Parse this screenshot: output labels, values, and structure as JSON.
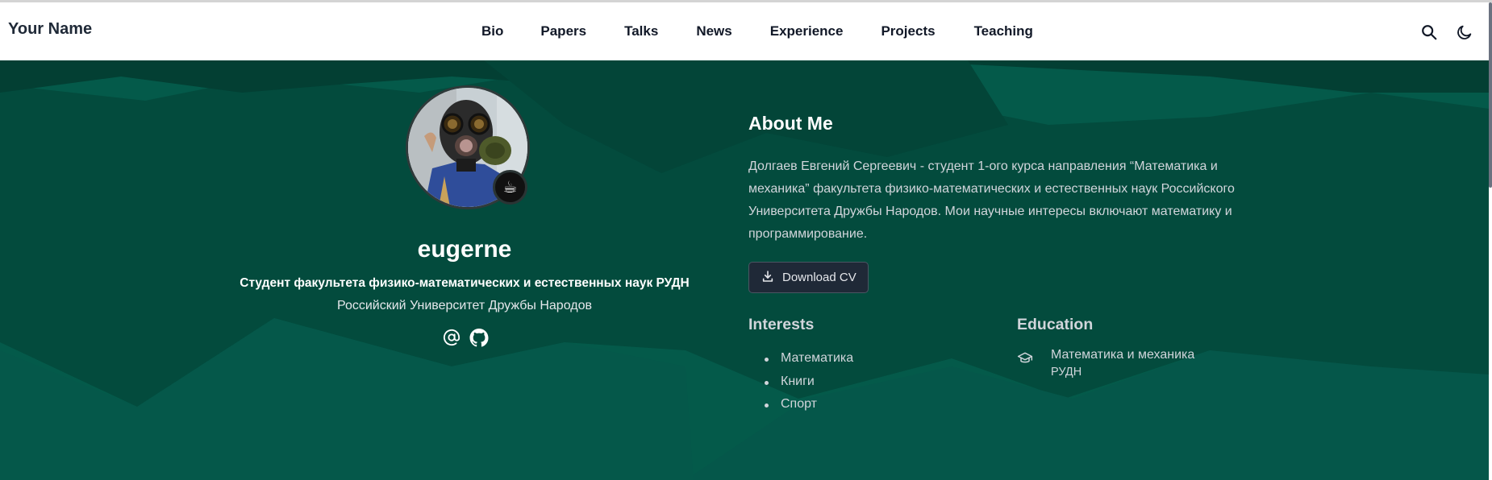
{
  "brand": "Your Name",
  "nav": {
    "links": [
      "Bio",
      "Papers",
      "Talks",
      "News",
      "Experience",
      "Projects",
      "Teaching"
    ],
    "search_icon": "search-icon",
    "theme_icon": "moon-icon"
  },
  "profile": {
    "avatar_badge": "☕",
    "username": "eugerne",
    "role": "Студент факультета физико-математических и естественных наук РУДН",
    "organization": "Российский Университет Дружбы Народов",
    "socials": [
      "at-sign-icon",
      "github-icon"
    ]
  },
  "about": {
    "title": "About Me",
    "text": "Долгаев Евгений Сергеевич - студент 1-ого курса направления “Математика и механика” факультета физико-математических и естественных наук Российского Университета Дружбы Народов. Мои научные интересы включают математику и программирование.",
    "cv_button": "Download CV"
  },
  "interests": {
    "title": "Interests",
    "items": [
      "Математика",
      "Книги",
      "Спорт"
    ]
  },
  "education": {
    "title": "Education",
    "course": "Математика и механика",
    "institution": "РУДН"
  },
  "colors": {
    "hero_bg": "#045a4a",
    "hero_dark": "#033f32",
    "navbar_bg": "#ffffff",
    "button_bg": "#1f2937"
  }
}
